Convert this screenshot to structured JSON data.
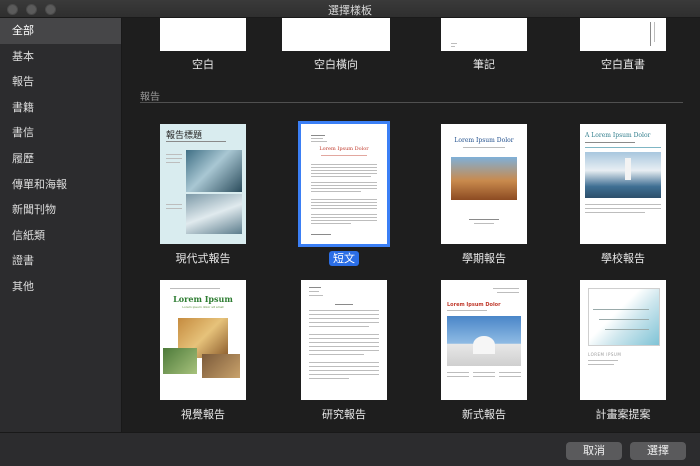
{
  "window": {
    "title": "選擇樣板"
  },
  "sidebar": {
    "items": [
      {
        "label": "全部",
        "active": true
      },
      {
        "label": "基本"
      },
      {
        "label": "報告"
      },
      {
        "label": "書籍"
      },
      {
        "label": "書信"
      },
      {
        "label": "履歷"
      },
      {
        "label": "傳單和海報"
      },
      {
        "label": "新聞刊物"
      },
      {
        "label": "信紙類"
      },
      {
        "label": "證書"
      },
      {
        "label": "其他"
      }
    ]
  },
  "basic": {
    "items": [
      {
        "label": "空白"
      },
      {
        "label": "空白橫向"
      },
      {
        "label": "筆記"
      },
      {
        "label": "空白直書"
      }
    ]
  },
  "reports": {
    "section_title": "報告",
    "items": [
      {
        "label": "現代式報告",
        "page_title": "報告標題"
      },
      {
        "label": "短文",
        "page_title": "Lorem Ipsum Dolor",
        "selected": true
      },
      {
        "label": "學期報告",
        "page_title": "Lorem Ipsum Dolor"
      },
      {
        "label": "學校報告",
        "page_title": "A Lorem Ipsum Dolor"
      },
      {
        "label": "視覺報告",
        "page_title": "Lorem Ipsum",
        "page_sub": "Lorem ipsum dolor sit amet"
      },
      {
        "label": "研究報告"
      },
      {
        "label": "新式報告",
        "page_title": "Lorem Ipsum Dolor"
      },
      {
        "label": "計畫案提案",
        "page_title": "LOREM IPSUM"
      }
    ]
  },
  "footer": {
    "cancel_label": "取消",
    "choose_label": "選擇"
  },
  "colors": {
    "accent": "#2b6ee6",
    "sidebar_bg": "#2c2c2e",
    "content_bg": "#1e1e1e",
    "serif_red": "#c0392b",
    "green": "#2e7d32",
    "teal": "#2f7d8c",
    "blue_title": "#1f4e8c"
  }
}
